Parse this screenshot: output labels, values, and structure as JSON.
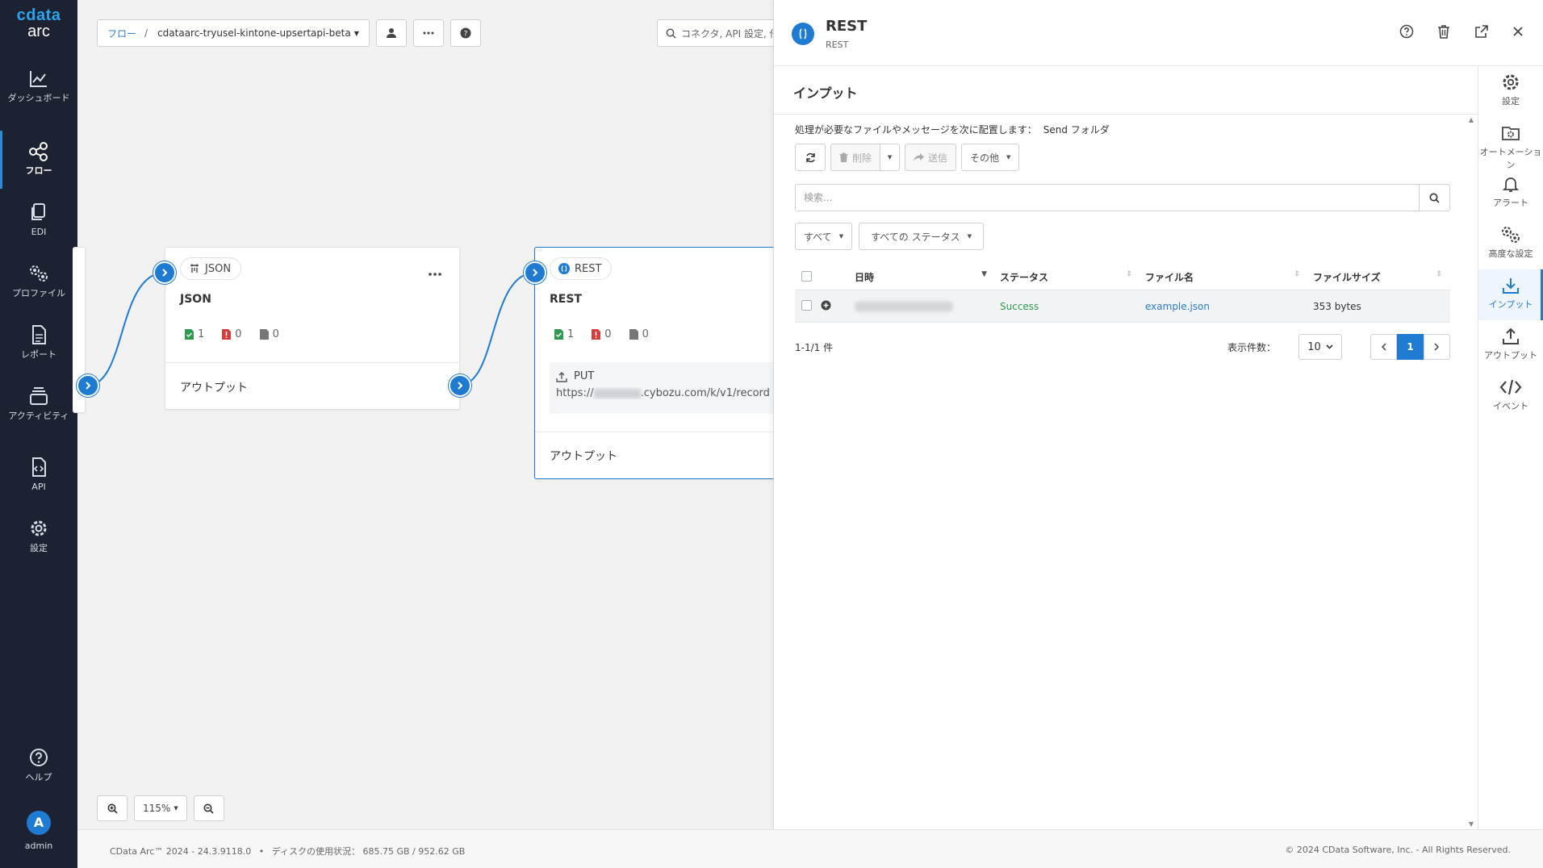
{
  "nav": {
    "logo_top": "cdata",
    "logo_bottom": "arc",
    "items": [
      {
        "label": "ダッシュボード",
        "icon": "chart-line-icon"
      },
      {
        "label": "フロー",
        "icon": "flow-icon",
        "active": true
      },
      {
        "label": "EDI",
        "icon": "copy-icon"
      },
      {
        "label": "プロファイル",
        "icon": "gears-icon"
      },
      {
        "label": "レポート",
        "icon": "report-icon"
      },
      {
        "label": "アクティビティ",
        "icon": "layers-icon"
      },
      {
        "label": "API",
        "icon": "code-file-icon"
      },
      {
        "label": "設定",
        "icon": "gear-icon"
      }
    ],
    "help": "ヘルプ",
    "avatar_letter": "A",
    "user": "admin"
  },
  "canvas": {
    "breadcrumb_root": "フロー",
    "breadcrumb_sep": "/",
    "flow_name": "cdataarc-tryusel-kintone-upsertapi-beta",
    "search_placeholder": "コネクタ, API 設定, 他",
    "zoom_level": "115%",
    "nodes": {
      "json": {
        "tag": "JSON",
        "title": "JSON",
        "count_success": "1",
        "count_error": "0",
        "count_pending": "0",
        "output_label": "アウトプット"
      },
      "rest": {
        "tag": "REST",
        "title": "REST",
        "count_success": "1",
        "count_error": "0",
        "count_pending": "0",
        "method": "PUT",
        "url_prefix": "https://",
        "url_suffix": ".cybozu.com/k/v1/record",
        "output_label": "アウトプット"
      }
    }
  },
  "panel": {
    "title": "REST",
    "subtitle": "REST",
    "section_title": "インプット",
    "hint_text": "処理が必要なファイルやメッセージを次に配置します：",
    "hint_folder": "Send フォルダ",
    "toolbar": {
      "delete": "削除",
      "send": "送信",
      "more": "その他"
    },
    "search_placeholder": "検索...",
    "filter_all": "すべて",
    "filter_status": "すべての ステータス",
    "columns": [
      "日時",
      "ステータス",
      "ファイル名",
      "ファイルサイズ"
    ],
    "rows": [
      {
        "status": "Success",
        "filename": "example.json",
        "size": "353 bytes"
      }
    ],
    "count_text": "1-1/1 件",
    "page_size_label": "表示件数：",
    "page_size": "10",
    "current_page": "1",
    "right_tabs": [
      {
        "label": "設定",
        "icon": "gear-icon"
      },
      {
        "label": "オートメーション",
        "icon": "folder-gear-icon"
      },
      {
        "label": "アラート",
        "icon": "bell-icon"
      },
      {
        "label": "高度な設定",
        "icon": "gears-icon"
      },
      {
        "label": "インプット",
        "icon": "download-icon",
        "active": true
      },
      {
        "label": "アウトプット",
        "icon": "upload-icon"
      },
      {
        "label": "イベント",
        "icon": "code-icon"
      }
    ]
  },
  "footer": {
    "version": "CData Arc™ 2024 - 24.3.9118.0",
    "disk": "ディスクの使用状況： 685.75 GB / 952.62 GB",
    "copyright": "© 2024 CData Software, Inc. - All Rights Reserved."
  },
  "colors": {
    "nav_bg": "#1c2232",
    "accent": "#1f7bd1",
    "success": "#2e9a4f",
    "error": "#d93a3a"
  }
}
